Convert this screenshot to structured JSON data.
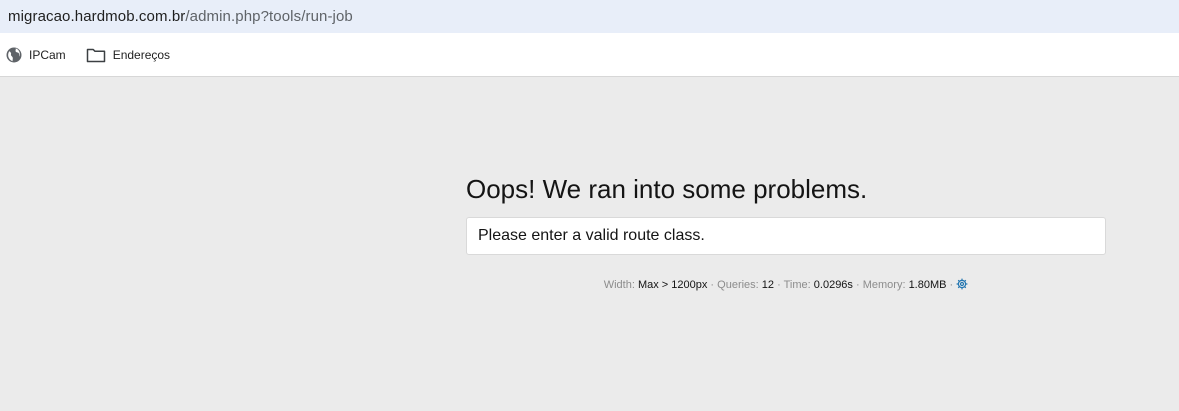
{
  "browser": {
    "url_host": "migracao.hardmob.com.br",
    "url_path": "/admin.php?tools/run-job",
    "bookmarks": [
      {
        "label": "IPCam",
        "icon": "globe-icon"
      },
      {
        "label": "Endereços",
        "icon": "folder-icon"
      }
    ]
  },
  "error": {
    "title": "Oops! We ran into some problems.",
    "message": "Please enter a valid route class."
  },
  "debug": {
    "width_label": "Width:",
    "width_value": "Max > 1200px",
    "queries_label": "Queries:",
    "queries_value": "12",
    "time_label": "Time:",
    "time_value": "0.0296s",
    "memory_label": "Memory:",
    "memory_value": "1.80MB",
    "separator": " · ",
    "icon": "gear-icon"
  },
  "colors": {
    "page_background": "#ebebeb",
    "addressbar_background": "#e8eef9",
    "gear_accent": "#2577b1"
  }
}
